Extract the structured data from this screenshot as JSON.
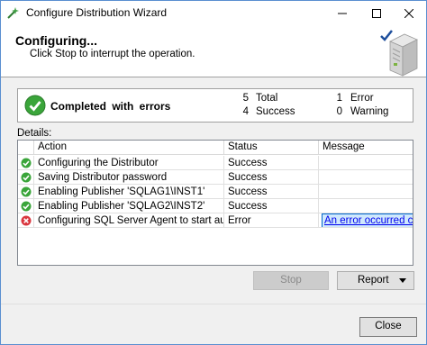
{
  "window": {
    "title": "Configure Distribution Wizard"
  },
  "header": {
    "title": "Configuring...",
    "subtitle": "Click Stop to interrupt the operation."
  },
  "summary": {
    "status_label": "Completed  with  errors",
    "total_count": "5",
    "total_label": "Total",
    "success_count": "4",
    "success_label": "Success",
    "error_count": "1",
    "error_label": "Error",
    "warning_count": "0",
    "warning_label": "Warning"
  },
  "details": {
    "label": "Details:",
    "columns": [
      "Action",
      "Status",
      "Message"
    ],
    "rows": [
      {
        "action": "Configuring the Distributor",
        "status": "Success",
        "message": "",
        "icon": "success-icon"
      },
      {
        "action": "Saving Distributor password",
        "status": "Success",
        "message": "",
        "icon": "success-icon"
      },
      {
        "action": "Enabling Publisher 'SQLAG1\\INST1'",
        "status": "Success",
        "message": "",
        "icon": "success-icon"
      },
      {
        "action": "Enabling Publisher 'SQLAG2\\INST2'",
        "status": "Success",
        "message": "",
        "icon": "success-icon"
      },
      {
        "action": "Configuring SQL Server Agent to start automat...",
        "status": "Error",
        "message": "An error occurred co...",
        "icon": "error-icon"
      }
    ]
  },
  "buttons": {
    "stop": "Stop",
    "report": "Report",
    "close": "Close"
  },
  "colors": {
    "success": "#3aa53a",
    "error": "#d9363e",
    "link": "#0000ee",
    "selection": "#cfe8fc"
  }
}
